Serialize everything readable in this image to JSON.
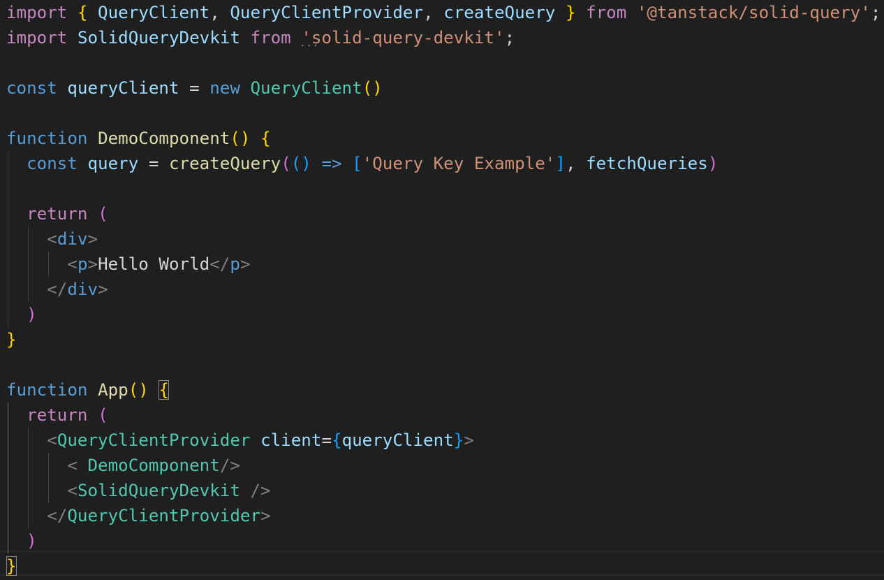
{
  "editor": {
    "language": "jsx",
    "lines": [
      [
        {
          "t": "import",
          "c": "kw"
        },
        {
          "t": " ",
          "c": "txt"
        },
        {
          "t": "{",
          "c": "b1"
        },
        {
          "t": " QueryClient",
          "c": "var"
        },
        {
          "t": ", ",
          "c": "txt"
        },
        {
          "t": "QueryClientProvider",
          "c": "var"
        },
        {
          "t": ", ",
          "c": "txt"
        },
        {
          "t": "createQuery",
          "c": "var"
        },
        {
          "t": " ",
          "c": "txt"
        },
        {
          "t": "}",
          "c": "b1"
        },
        {
          "t": " ",
          "c": "txt"
        },
        {
          "t": "from",
          "c": "kw"
        },
        {
          "t": " ",
          "c": "txt"
        },
        {
          "t": "'@tanstack/solid-query'",
          "c": "str"
        },
        {
          "t": ";",
          "c": "txt"
        }
      ],
      [
        {
          "t": "import",
          "c": "kw"
        },
        {
          "t": " ",
          "c": "txt"
        },
        {
          "t": "SolidQueryDevkit",
          "c": "var"
        },
        {
          "t": " ",
          "c": "txt"
        },
        {
          "t": "from",
          "c": "kw"
        },
        {
          "t": " ",
          "c": "txt"
        },
        {
          "t": "'solid-query-devkit'",
          "c": "str"
        },
        {
          "t": ";",
          "c": "txt"
        }
      ],
      [],
      [
        {
          "t": "const",
          "c": "sto"
        },
        {
          "t": " ",
          "c": "txt"
        },
        {
          "t": "queryClient",
          "c": "var"
        },
        {
          "t": " = ",
          "c": "txt"
        },
        {
          "t": "new",
          "c": "sto"
        },
        {
          "t": " ",
          "c": "txt"
        },
        {
          "t": "QueryClient",
          "c": "cls"
        },
        {
          "t": "()",
          "c": "b1"
        }
      ],
      [],
      [
        {
          "t": "function",
          "c": "sto"
        },
        {
          "t": " ",
          "c": "txt"
        },
        {
          "t": "DemoComponent",
          "c": "fn"
        },
        {
          "t": "()",
          "c": "b1"
        },
        {
          "t": " ",
          "c": "txt"
        },
        {
          "t": "{",
          "c": "b1"
        }
      ],
      [
        {
          "t": "  ",
          "c": "txt"
        },
        {
          "t": "const",
          "c": "sto"
        },
        {
          "t": " ",
          "c": "txt"
        },
        {
          "t": "query",
          "c": "var"
        },
        {
          "t": " = ",
          "c": "txt"
        },
        {
          "t": "createQuery",
          "c": "fn"
        },
        {
          "t": "(",
          "c": "b2"
        },
        {
          "t": "()",
          "c": "b3"
        },
        {
          "t": " ",
          "c": "txt"
        },
        {
          "t": "=>",
          "c": "sto"
        },
        {
          "t": " ",
          "c": "txt"
        },
        {
          "t": "[",
          "c": "b3"
        },
        {
          "t": "'Query Key Example'",
          "c": "str"
        },
        {
          "t": "]",
          "c": "b3"
        },
        {
          "t": ", ",
          "c": "txt"
        },
        {
          "t": "fetchQueries",
          "c": "var"
        },
        {
          "t": ")",
          "c": "b2"
        }
      ],
      [],
      [
        {
          "t": "  ",
          "c": "txt"
        },
        {
          "t": "return",
          "c": "kw"
        },
        {
          "t": " ",
          "c": "txt"
        },
        {
          "t": "(",
          "c": "b2"
        }
      ],
      [
        {
          "t": "    ",
          "c": "txt"
        },
        {
          "t": "<",
          "c": "tag"
        },
        {
          "t": "div",
          "c": "htm"
        },
        {
          "t": ">",
          "c": "tag"
        }
      ],
      [
        {
          "t": "      ",
          "c": "txt"
        },
        {
          "t": "<",
          "c": "tag"
        },
        {
          "t": "p",
          "c": "htm"
        },
        {
          "t": ">",
          "c": "tag"
        },
        {
          "t": "Hello World",
          "c": "txt"
        },
        {
          "t": "</",
          "c": "tag"
        },
        {
          "t": "p",
          "c": "htm"
        },
        {
          "t": ">",
          "c": "tag"
        }
      ],
      [
        {
          "t": "    ",
          "c": "txt"
        },
        {
          "t": "</",
          "c": "tag"
        },
        {
          "t": "div",
          "c": "htm"
        },
        {
          "t": ">",
          "c": "tag"
        }
      ],
      [
        {
          "t": "  ",
          "c": "txt"
        },
        {
          "t": ")",
          "c": "b2"
        }
      ],
      [
        {
          "t": "}",
          "c": "b1"
        }
      ],
      [],
      [
        {
          "t": "function",
          "c": "sto"
        },
        {
          "t": " ",
          "c": "txt"
        },
        {
          "t": "App",
          "c": "fn"
        },
        {
          "t": "()",
          "c": "b1"
        },
        {
          "t": " ",
          "c": "txt"
        },
        {
          "t": "{",
          "c": "b1",
          "m": true
        }
      ],
      [
        {
          "t": "  ",
          "c": "txt"
        },
        {
          "t": "return",
          "c": "kw"
        },
        {
          "t": " ",
          "c": "txt"
        },
        {
          "t": "(",
          "c": "b2"
        }
      ],
      [
        {
          "t": "    ",
          "c": "txt"
        },
        {
          "t": "<",
          "c": "tag"
        },
        {
          "t": "QueryClientProvider",
          "c": "cls"
        },
        {
          "t": " ",
          "c": "txt"
        },
        {
          "t": "client",
          "c": "var"
        },
        {
          "t": "=",
          "c": "txt"
        },
        {
          "t": "{",
          "c": "b3"
        },
        {
          "t": "queryClient",
          "c": "var"
        },
        {
          "t": "}",
          "c": "b3"
        },
        {
          "t": ">",
          "c": "tag"
        }
      ],
      [
        {
          "t": "      ",
          "c": "txt"
        },
        {
          "t": "< ",
          "c": "tag"
        },
        {
          "t": "DemoComponent",
          "c": "cls"
        },
        {
          "t": "/>",
          "c": "tag"
        }
      ],
      [
        {
          "t": "      ",
          "c": "txt"
        },
        {
          "t": "<",
          "c": "tag"
        },
        {
          "t": "SolidQueryDevkit",
          "c": "cls"
        },
        {
          "t": " ",
          "c": "txt"
        },
        {
          "t": "/>",
          "c": "tag"
        }
      ],
      [
        {
          "t": "    ",
          "c": "txt"
        },
        {
          "t": "</",
          "c": "tag"
        },
        {
          "t": "QueryClientProvider",
          "c": "cls"
        },
        {
          "t": ">",
          "c": "tag"
        }
      ],
      [
        {
          "t": "  ",
          "c": "txt"
        },
        {
          "t": ")",
          "c": "b2"
        }
      ],
      [
        {
          "t": "}",
          "c": "b1",
          "m": true
        }
      ]
    ]
  }
}
